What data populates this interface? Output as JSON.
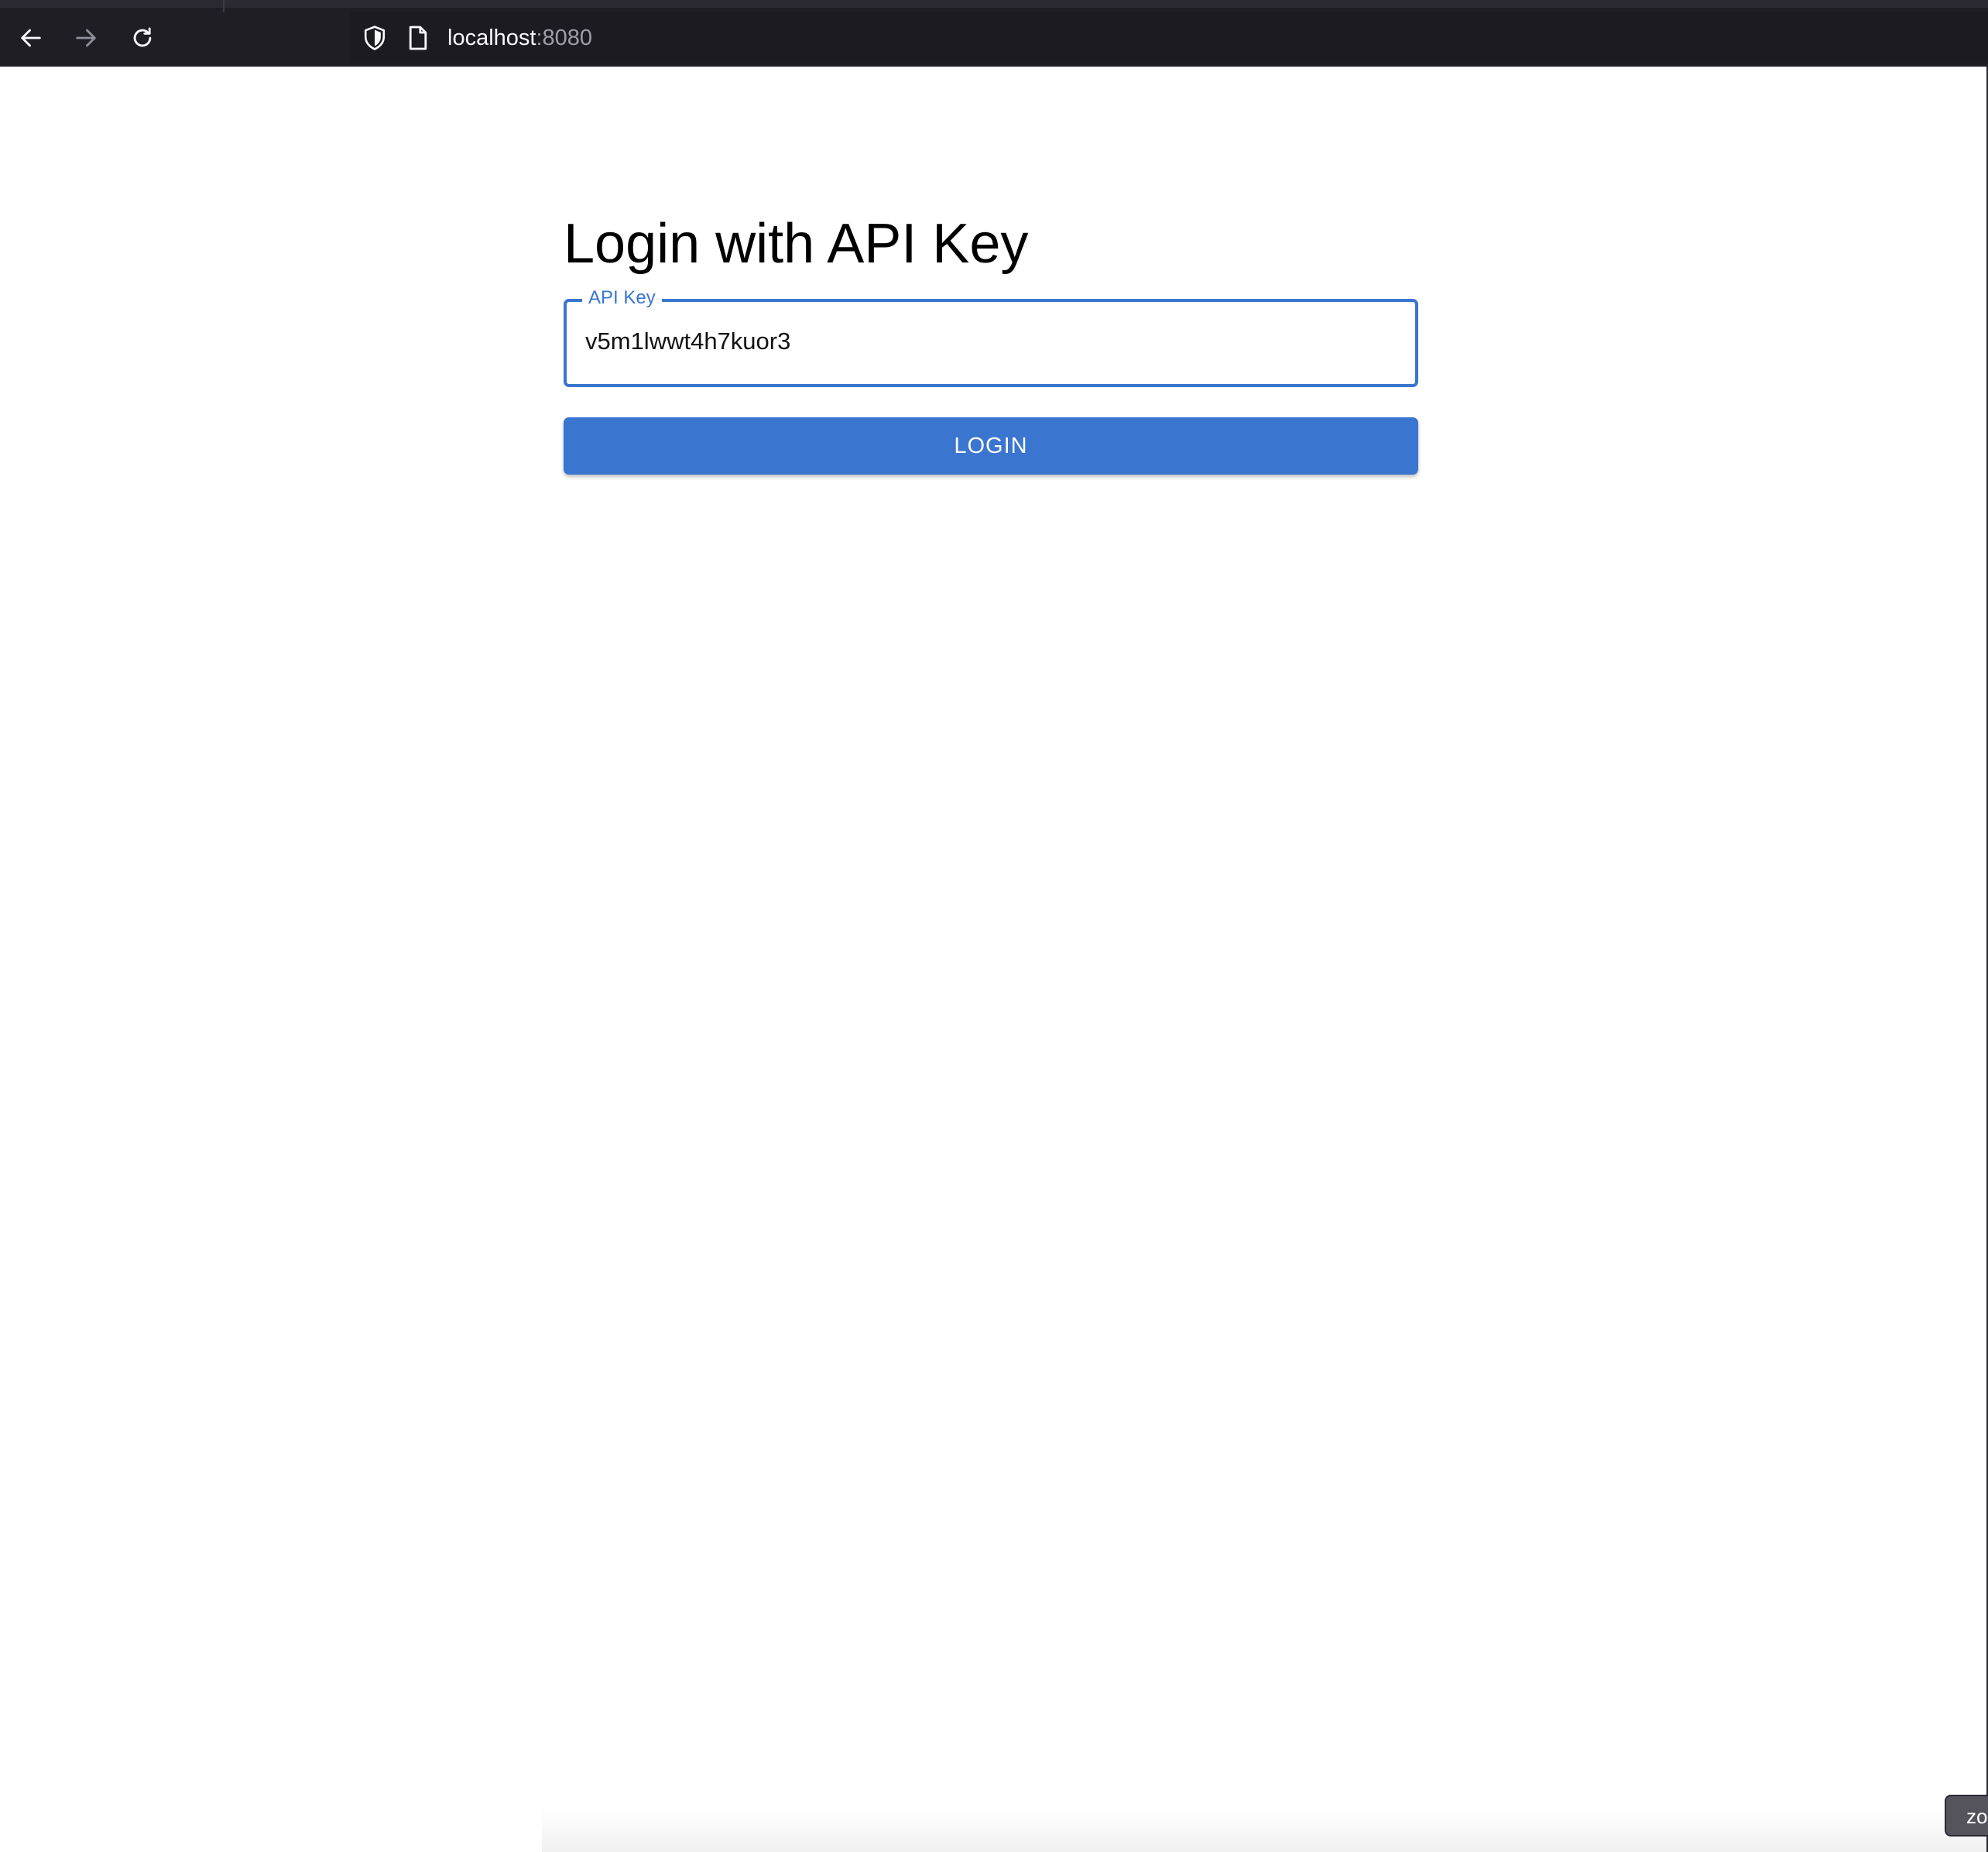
{
  "browser": {
    "url_host": "localhost",
    "url_port": ":8080"
  },
  "page": {
    "title": "Login with API Key"
  },
  "form": {
    "api_key_label": "API Key",
    "api_key_value": "v5m1lwwt4h7kuor3",
    "login_label": "LOGIN"
  },
  "zoom_indicator": {
    "label": "zo"
  },
  "colors": {
    "accent": "#3a75cf",
    "toolbar": "#1f1e25"
  }
}
